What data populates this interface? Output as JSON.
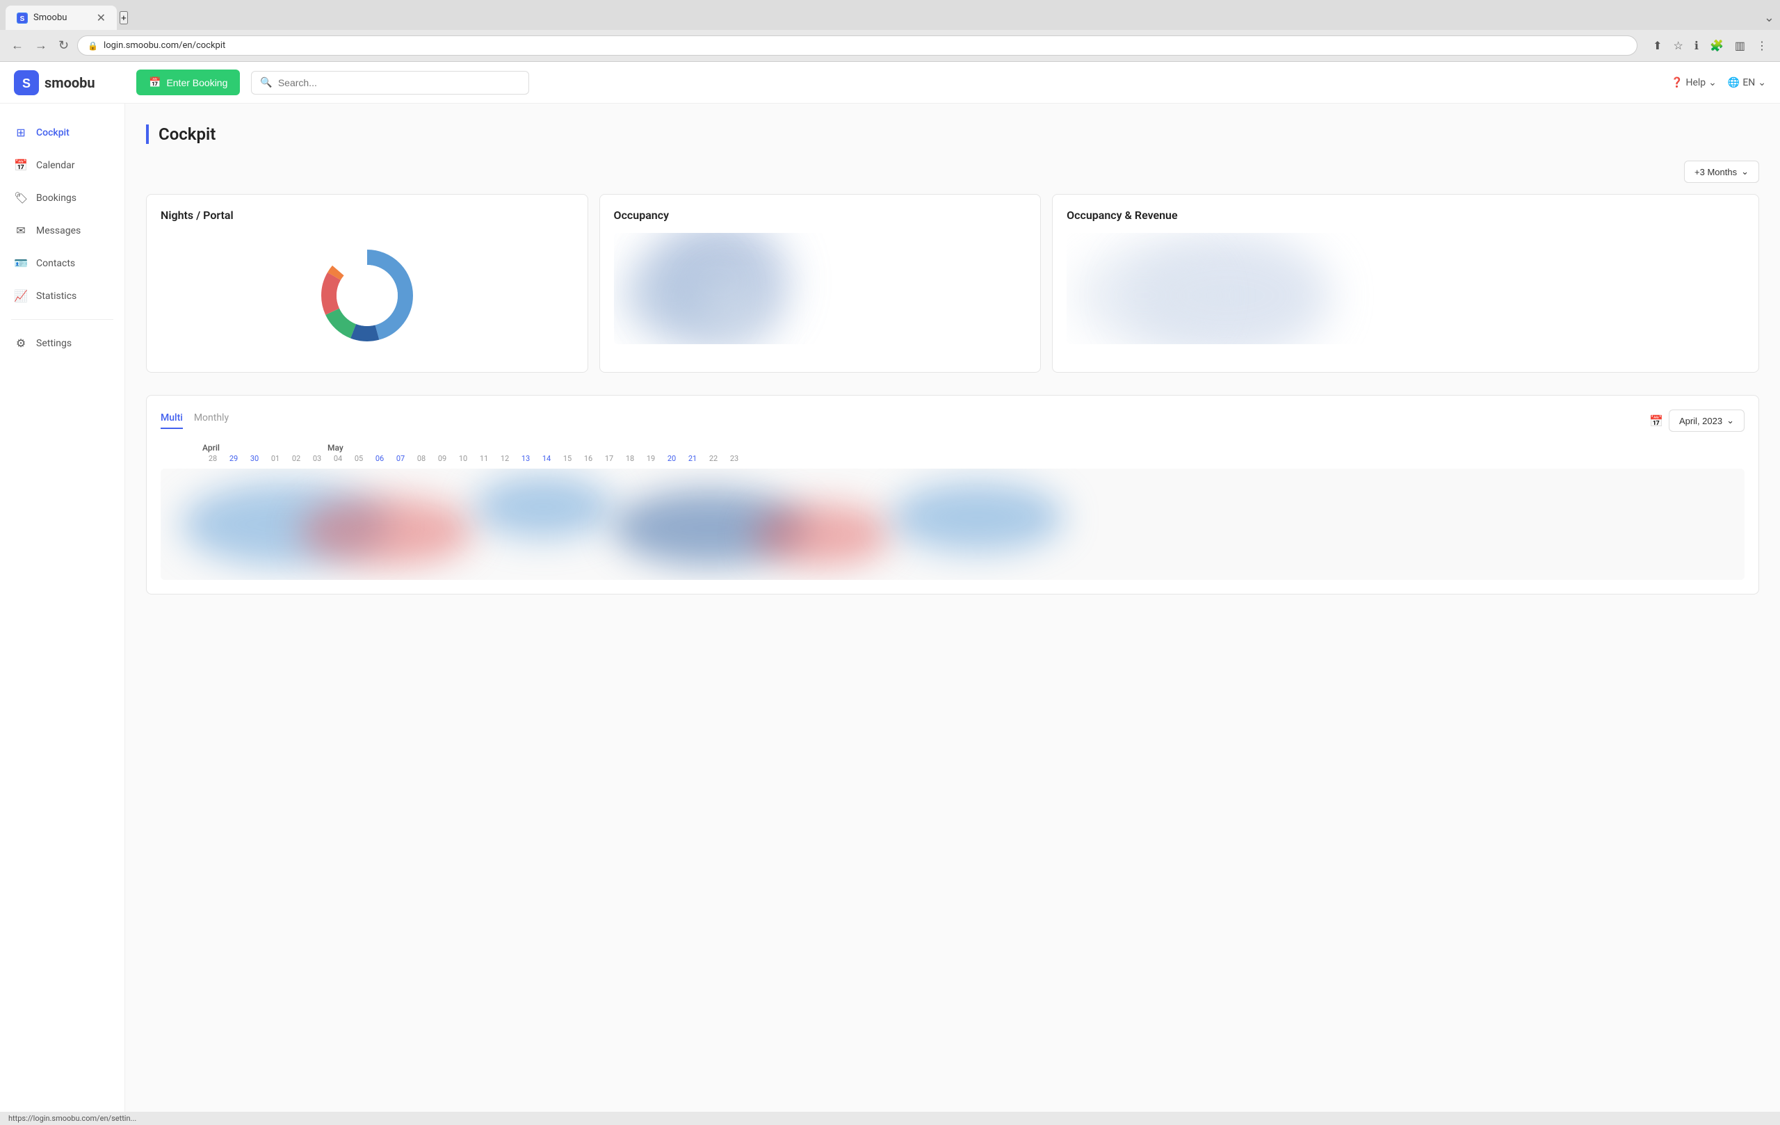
{
  "browser": {
    "tab_favicon": "S",
    "tab_title": "Smoobu",
    "url": "login.smoobu.com/en/cockpit",
    "status_bar_url": "https://login.smoobu.com/en/settin..."
  },
  "header": {
    "logo_letter": "S",
    "logo_name": "smoobu",
    "enter_booking_label": "Enter Booking",
    "search_placeholder": "Search...",
    "help_label": "Help",
    "lang_label": "EN"
  },
  "sidebar": {
    "items": [
      {
        "id": "cockpit",
        "label": "Cockpit",
        "active": true
      },
      {
        "id": "calendar",
        "label": "Calendar",
        "active": false
      },
      {
        "id": "bookings",
        "label": "Bookings",
        "active": false
      },
      {
        "id": "messages",
        "label": "Messages",
        "active": false
      },
      {
        "id": "contacts",
        "label": "Contacts",
        "active": false
      },
      {
        "id": "statistics",
        "label": "Statistics",
        "active": false
      },
      {
        "id": "settings",
        "label": "Settings",
        "active": false
      }
    ]
  },
  "page": {
    "title": "Cockpit"
  },
  "months_filter": {
    "label": "+3 Months"
  },
  "cards": [
    {
      "id": "nights-portal",
      "title": "Nights / Portal",
      "type": "donut"
    },
    {
      "id": "occupancy",
      "title": "Occupancy",
      "type": "blurred"
    },
    {
      "id": "occupancy-revenue",
      "title": "Occupancy & Revenue",
      "type": "blurred"
    }
  ],
  "donut": {
    "segments": [
      {
        "color": "#5b9bd5",
        "value": 45
      },
      {
        "color": "#2d5fa0",
        "value": 10
      },
      {
        "color": "#3cb371",
        "value": 12
      },
      {
        "color": "#e06060",
        "value": 15
      },
      {
        "color": "#f08040",
        "value": 5
      }
    ]
  },
  "calendar": {
    "tabs": [
      {
        "id": "multi",
        "label": "Multi",
        "active": true
      },
      {
        "id": "monthly",
        "label": "Monthly",
        "active": false
      }
    ],
    "current_month": "April, 2023",
    "months": [
      "April",
      "May"
    ],
    "days": [
      "28",
      "29",
      "30",
      "01",
      "02",
      "03",
      "04",
      "05",
      "06",
      "07",
      "08",
      "09",
      "10",
      "11",
      "12",
      "13",
      "14",
      "15",
      "16",
      "17",
      "18",
      "19",
      "20",
      "21",
      "22",
      "23"
    ],
    "weekend_days": [
      "29",
      "30",
      "06",
      "07",
      "13",
      "14",
      "20",
      "21"
    ]
  }
}
